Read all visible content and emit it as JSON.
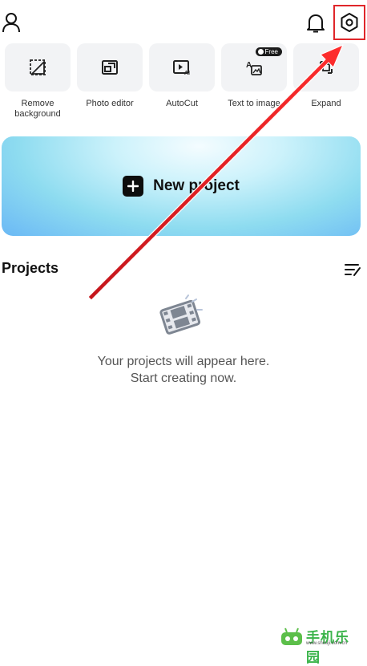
{
  "header": {
    "profile_icon": "person-icon",
    "notifications_icon": "bell-icon",
    "settings_icon": "settings-hexagon-icon",
    "highlight_color": "#e0262a"
  },
  "tools": [
    {
      "label": "Remove\nbackground",
      "icon": "remove-background-icon"
    },
    {
      "label": "Photo editor",
      "icon": "photo-editor-icon"
    },
    {
      "label": "AutoCut",
      "icon": "autocut-icon"
    },
    {
      "label": "Text to image",
      "icon": "text-to-image-icon",
      "badge": "Free"
    },
    {
      "label": "Expand",
      "icon": "expand-icon"
    }
  ],
  "new_project": {
    "label": "New project",
    "icon": "plus-icon"
  },
  "projects": {
    "title": "Projects",
    "sort_icon": "sort-icon",
    "empty_line1": "Your projects will appear here.",
    "empty_line2": "Start creating now."
  },
  "watermark": {
    "text": "手机乐园",
    "sub": "www.shouji.com.cn"
  }
}
